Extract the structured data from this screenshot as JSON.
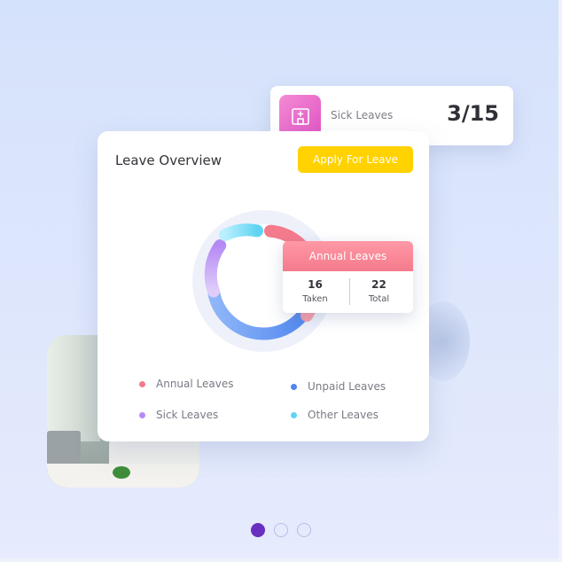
{
  "sick_card": {
    "label": "Sick Leaves",
    "count": "3/15",
    "icon": "hospital-icon"
  },
  "overview": {
    "title": "Leave Overview",
    "apply_button": "Apply For Leave",
    "tooltip": {
      "title": "Annual Leaves",
      "taken_value": "16",
      "taken_label": "Taken",
      "total_value": "22",
      "total_label": "Total"
    },
    "legend": [
      {
        "label": "Annual Leaves",
        "color": "#f47b8c"
      },
      {
        "label": "Unpaid Leaves",
        "color": "#4f86f0"
      },
      {
        "label": "Sick Leaves",
        "color": "#b58af5"
      },
      {
        "label": "Other Leaves",
        "color": "#5fd4f2"
      }
    ]
  },
  "colors": {
    "accent_yellow": "#ffd200",
    "pager_active": "#6a2fc1"
  },
  "pager": {
    "count": 3,
    "active_index": 0
  }
}
